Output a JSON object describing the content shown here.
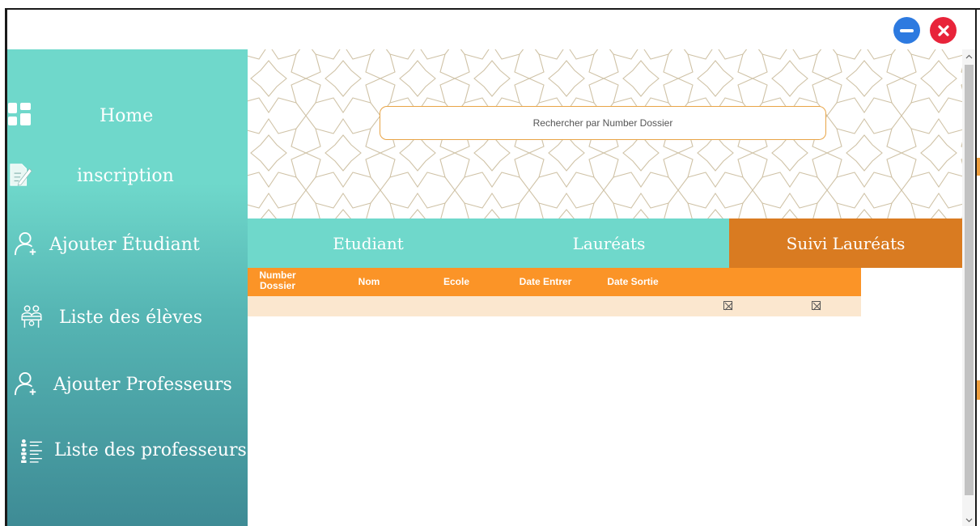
{
  "window": {
    "minimize_label": "",
    "close_label": ""
  },
  "sidebar": {
    "items": [
      {
        "label": "Home",
        "icon": "dashboard-icon"
      },
      {
        "label": "inscription",
        "icon": "edit-document-icon"
      },
      {
        "label": "Ajouter Étudiant",
        "icon": "add-user-icon"
      },
      {
        "label": "Liste des élèves",
        "icon": "students-icon"
      },
      {
        "label": "Ajouter Professeurs",
        "icon": "add-user-icon"
      },
      {
        "label": "Liste des professeurs",
        "icon": "list-people-icon"
      }
    ]
  },
  "search": {
    "placeholder": "Rechercher par Number Dossier"
  },
  "tabs": [
    {
      "label": "Etudiant",
      "active": false
    },
    {
      "label": "Lauréats",
      "active": false
    },
    {
      "label": "Suivi Lauréats",
      "active": true
    }
  ],
  "table": {
    "headers": [
      "Number Dossier",
      "Nom",
      "Ecole",
      "Date Entrer",
      "Date Sortie"
    ],
    "rows": [
      {
        "checkbox_1": "unchecked",
        "checkbox_2": "unchecked"
      }
    ]
  },
  "colors": {
    "sidebar_top": "#6fd8cb",
    "sidebar_bottom": "#3e8b95",
    "tab_teal": "#6fd8cb",
    "tab_active": "#d97b21",
    "table_header": "#fb9427",
    "table_row": "#fbe7cf",
    "search_border": "#e8a446",
    "minimize": "#2d7ae0",
    "close": "#e8243a"
  }
}
